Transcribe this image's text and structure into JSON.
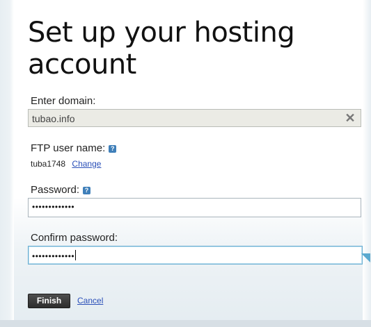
{
  "page": {
    "title": "Set up your hosting account"
  },
  "form": {
    "domain_label": "Enter domain:",
    "domain_value": "tubao.info",
    "ftp_label": "FTP user name:",
    "ftp_user": "tuba1748",
    "ftp_change": "Change",
    "password_label": "Password:",
    "password_value": "•••••••••••••",
    "confirm_label": "Confirm password:",
    "confirm_value": "•••••••••••••",
    "help_glyph": "?",
    "clear_glyph": "✕"
  },
  "actions": {
    "finish": "Finish",
    "cancel": "Cancel"
  },
  "colors": {
    "accent": "#2a4fb8",
    "focus": "#6aaed2",
    "button": "#333333"
  }
}
